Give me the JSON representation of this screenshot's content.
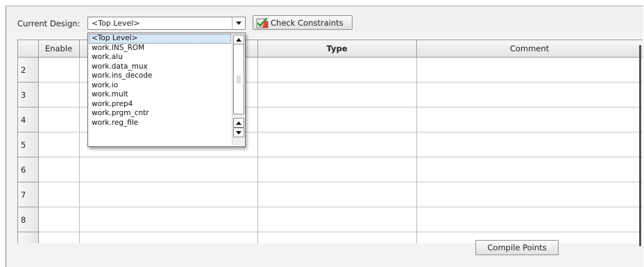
{
  "toolbar": {
    "current_design_label": "Current Design:",
    "current_design_value": "<Top Level>",
    "check_constraints_label": "Check Constraints"
  },
  "grid": {
    "columns": [
      "",
      "Enable",
      "",
      "Type",
      "Comment"
    ],
    "row_numbers": [
      "2",
      "3",
      "4",
      "5",
      "6",
      "7",
      "8",
      ""
    ]
  },
  "dropdown": {
    "items": [
      "<Top Level>",
      "work.INS_ROM",
      "work.alu",
      "work.data_mux",
      "work.ins_decode",
      "work.io",
      "work.mult",
      "work.prep4",
      "work.prgm_cntr",
      "work.reg_file"
    ],
    "selected_index": 0
  },
  "footer": {
    "compile_points_label": "Compile Points"
  },
  "icons": {
    "check_constraints": "check-constraints-icon",
    "dropdown_arrow": "chevron-down-icon"
  }
}
